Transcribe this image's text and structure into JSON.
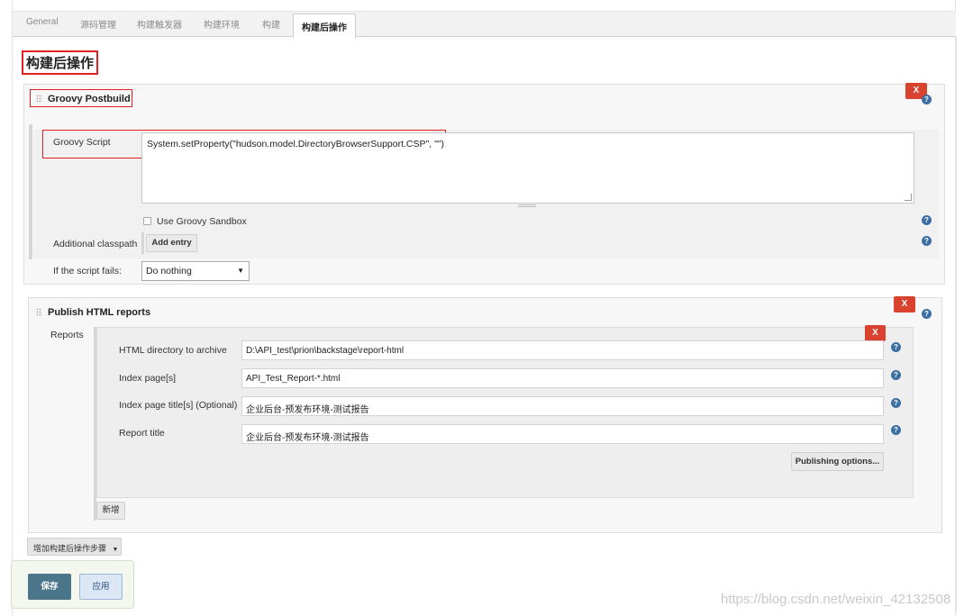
{
  "tabs": [
    "General",
    "源码管理",
    "构建触发器",
    "构建环境",
    "构建",
    "构建后操作"
  ],
  "page_title": "构建后操作",
  "groovy": {
    "section_title": "Groovy Postbuild",
    "delete_label": "X",
    "script_label": "Groovy Script",
    "script_value": "System.setProperty(\"hudson.model.DirectoryBrowserSupport.CSP\", \"\")",
    "sandbox_label": "Use Groovy Sandbox",
    "classpath_label": "Additional classpath",
    "add_entry_label": "Add entry",
    "fails_label": "If the script fails:",
    "fails_value": "Do nothing"
  },
  "html_reports": {
    "section_title": "Publish HTML reports",
    "delete_label": "X",
    "reports_label": "Reports",
    "report_delete_label": "X",
    "dir_label": "HTML directory to archive",
    "dir_value": "D:\\API_test\\prion\\backstage\\report-html",
    "index_label": "Index page[s]",
    "index_value": "API_Test_Report-*.html",
    "index_title_label": "Index page title[s] (Optional)",
    "index_title_value": "企业后台-预发布环境-测试报告",
    "report_title_label": "Report title",
    "report_title_value": "企业后台-预发布环境-测试报告",
    "publishing_options_label": "Publishing options...",
    "add_label": "新增"
  },
  "add_step_label": "增加构建后操作步骤",
  "save_label": "保存",
  "apply_label": "应用",
  "watermark": "https://blog.csdn.net/weixin_42132508",
  "colors": {
    "highlight": "#e02020",
    "delete": "#d9422e",
    "save": "#4b758b",
    "help": "#3c6fa3"
  }
}
